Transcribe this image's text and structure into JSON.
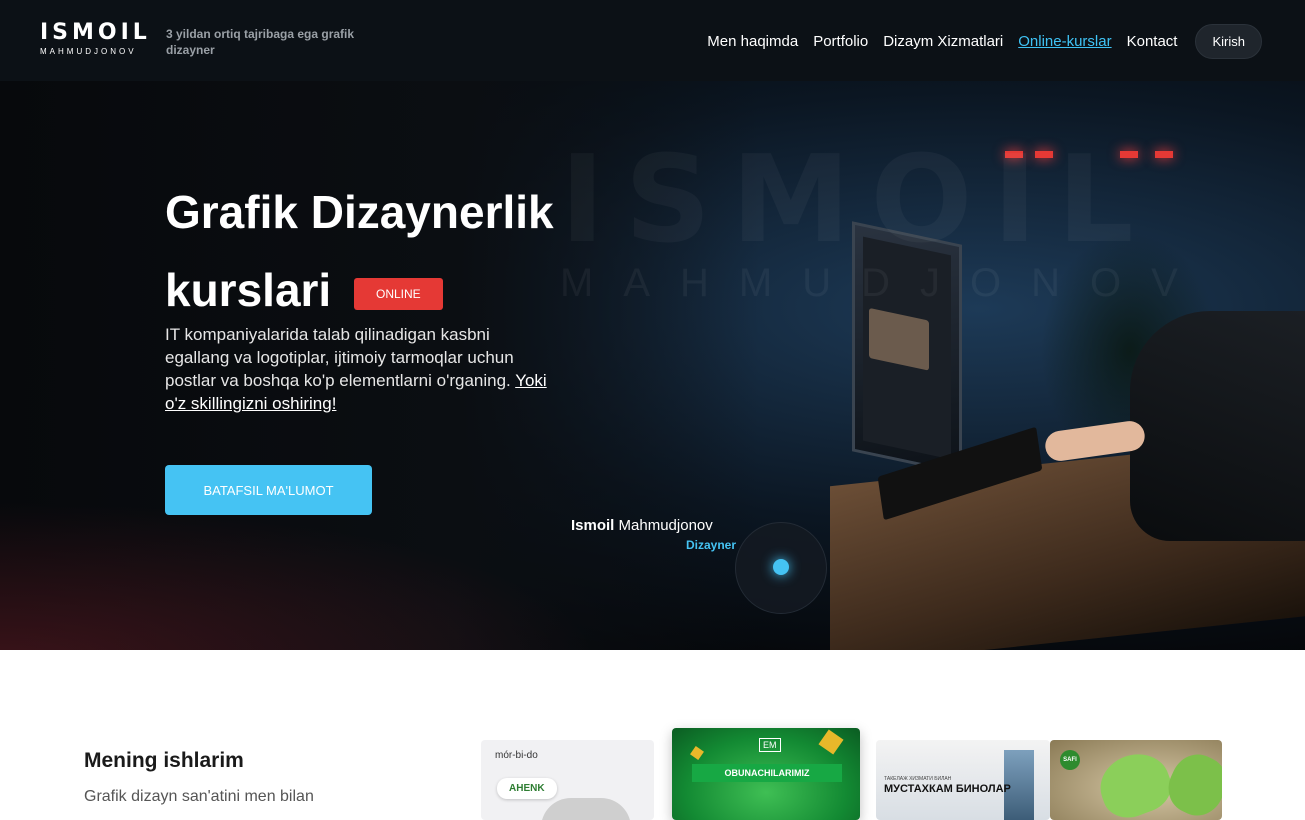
{
  "header": {
    "logo_main": "ISMOIL",
    "logo_sub": "MAHMUDJONOV",
    "tagline": "3 yildan ortiq tajribaga ega grafik dizayner",
    "nav": [
      {
        "label": "Men haqimda"
      },
      {
        "label": "Portfolio"
      },
      {
        "label": "Dizaym Xizmatlari"
      },
      {
        "label": "Online-kurslar"
      },
      {
        "label": "Kontact"
      }
    ],
    "active_nav": "Online-kurslar",
    "login_label": "Kirish"
  },
  "hero": {
    "title_line1": "Grafik Dizaynerlik",
    "title_line2": "kurslari",
    "badge": "ONLINE",
    "description": "IT kompaniyalarida talab qilinadigan kasbni egallang va logotiplar, ijtimoiy tarmoqlar uchun postlar va boshqa ko'p elementlarni o'rganing.",
    "link_text": "Yoki o'z skillingizni oshiring!",
    "cta_label": "BATAFSIL MA'LUMOT",
    "signature_first": "Ismoil",
    "signature_last": "Mahmudjonov",
    "signature_role": "Dizayner"
  },
  "works": {
    "title": "Mening ishlarim",
    "description": "Grafik dizayn san'atini men bilan",
    "thumbs": [
      {
        "brand": "mór-bi-do",
        "pill": "AHENK"
      },
      {
        "logo": "EM",
        "band": "OBUNACHILARIMIZ"
      },
      {
        "small": "ТАКЕЛАЖ ХИЗМАТИ БИЛАН",
        "big": "МУСТАХКАМ БИНОЛАР"
      },
      {
        "badge": "SAFI"
      }
    ]
  },
  "colors": {
    "accent": "#45c3f3",
    "badge_red": "#e53935",
    "header_bg": "#0c1116"
  }
}
